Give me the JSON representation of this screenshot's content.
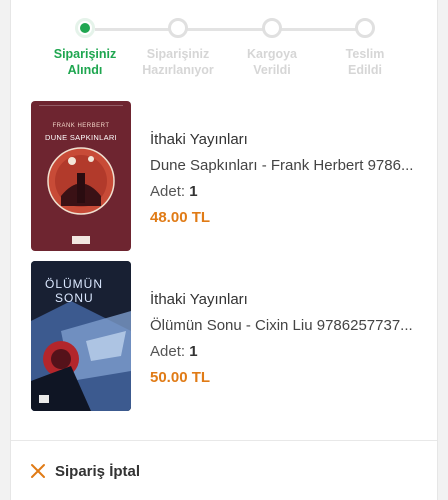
{
  "stepper": {
    "steps": [
      {
        "label_line1": "Siparişiniz",
        "label_line2": "Alındı",
        "active": true
      },
      {
        "label_line1": "Siparişiniz",
        "label_line2": "Hazırlanıyor",
        "active": false
      },
      {
        "label_line1": "Kargoya",
        "label_line2": "Verildi",
        "active": false
      },
      {
        "label_line1": "Teslim",
        "label_line2": "Edildi",
        "active": false
      }
    ]
  },
  "items": [
    {
      "publisher": "İthaki Yayınları",
      "title": "Dune Sapkınları - Frank Herbert 9786...",
      "qty_label": "Adet:",
      "qty": "1",
      "price": "48.00 TL",
      "cover": {
        "author": "FRANK HERBERT",
        "title": "DUNE SAPKINLARI"
      }
    },
    {
      "publisher": "İthaki Yayınları",
      "title": "Ölümün Sonu - Cixin Liu 9786257737...",
      "qty_label": "Adet:",
      "qty": "1",
      "price": "50.00 TL",
      "cover": {
        "title_line1": "ÖLÜMÜN",
        "title_line2": "SONU"
      }
    }
  ],
  "footer": {
    "cancel_label": "Sipariş İptal"
  },
  "colors": {
    "accent_green": "#1fa650",
    "price_orange": "#e07b16",
    "inactive_gray": "#d6d6d6"
  },
  "icons": {
    "cancel": "close-icon"
  }
}
